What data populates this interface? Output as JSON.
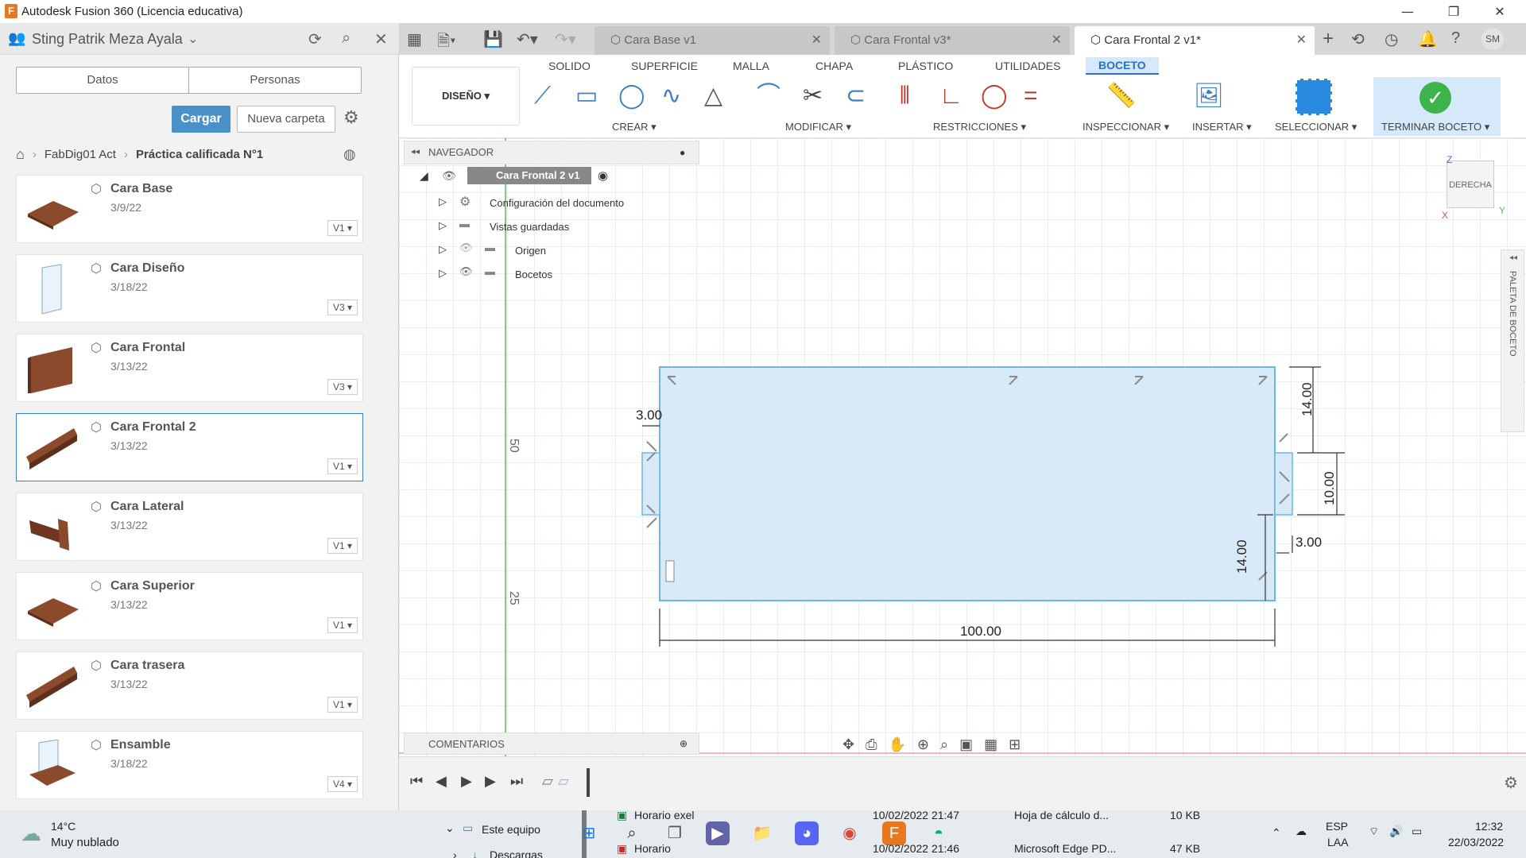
{
  "window": {
    "title": "Autodesk Fusion 360 (Licencia educativa)",
    "logo": "F"
  },
  "left": {
    "user": "Sting Patrik Meza Ayala",
    "tabs": [
      "Datos",
      "Personas"
    ],
    "upload": "Cargar",
    "new_folder": "Nueva carpeta",
    "breadcrumb": [
      "FabDig01 Act",
      "Práctica calificada N°1"
    ],
    "cards": [
      {
        "name": "Cara Base",
        "date": "3/9/22",
        "ver": "V1 ▾",
        "thumb": "flat"
      },
      {
        "name": "Cara Diseño",
        "date": "3/18/22",
        "ver": "V3 ▾",
        "thumb": "glass"
      },
      {
        "name": "Cara Frontal",
        "date": "3/13/22",
        "ver": "V3 ▾",
        "thumb": "board"
      },
      {
        "name": "Cara Frontal 2",
        "date": "3/13/22",
        "ver": "V1 ▾",
        "thumb": "plank"
      },
      {
        "name": "Cara Lateral",
        "date": "3/13/22",
        "ver": "V1 ▾",
        "thumb": "side"
      },
      {
        "name": "Cara Superior",
        "date": "3/13/22",
        "ver": "V1 ▾",
        "thumb": "flat"
      },
      {
        "name": "Cara trasera",
        "date": "3/13/22",
        "ver": "V1 ▾",
        "thumb": "plank"
      },
      {
        "name": "Ensamble",
        "date": "3/18/22",
        "ver": "V4 ▾",
        "thumb": "assembly"
      }
    ]
  },
  "doc_tabs": [
    {
      "label": "Cara Base v1",
      "active": false
    },
    {
      "label": "Cara Frontal v3*",
      "active": false
    },
    {
      "label": "Cara Frontal 2 v1*",
      "active": true
    }
  ],
  "toolbar": {
    "workspace": "DISEÑO ▾",
    "tabs": [
      "SOLIDO",
      "SUPERFICIE",
      "MALLA",
      "CHAPA",
      "PLÁSTICO",
      "UTILIDADES",
      "BOCETO"
    ],
    "groups": [
      "CREAR ▾",
      "MODIFICAR ▾",
      "RESTRICCIONES ▾",
      "INSPECCIONAR ▾",
      "INSERTAR ▾",
      "SELECCIONAR ▾",
      "TERMINAR BOCETO ▾"
    ]
  },
  "browser": {
    "title": "NAVEGADOR",
    "root": "Cara Frontal 2 v1",
    "nodes": [
      "Configuración del documento",
      "Vistas guardadas",
      "Origen",
      "Bocetos"
    ]
  },
  "comments": "COMENTARIOS",
  "viewcube": {
    "face": "DERECHA",
    "z": "Z",
    "y": "Y",
    "x": "X"
  },
  "palette": "PALETA DE BOCETO",
  "sketch": {
    "dims": [
      "3.00",
      "14.00",
      "10.00",
      "14.00",
      "3.00",
      "100.00"
    ],
    "ruler": [
      "50",
      "25"
    ]
  },
  "taskbar": {
    "weather": {
      "temp": "14°C",
      "desc": "Muy nublado"
    },
    "explorer": {
      "items": [
        "Este equipo",
        "Descargas"
      ]
    },
    "files": [
      {
        "name": "Horario exel",
        "date": "10/02/2022 21:47",
        "type": "Hoja de cálculo d...",
        "size": "10 KB"
      },
      {
        "name": "Horario",
        "date": "10/02/2022 21:46",
        "type": "Microsoft Edge PD...",
        "size": "47 KB"
      }
    ],
    "lang": "ESP",
    "lang2": "LAA",
    "time": "12:32",
    "date": "22/03/2022"
  }
}
